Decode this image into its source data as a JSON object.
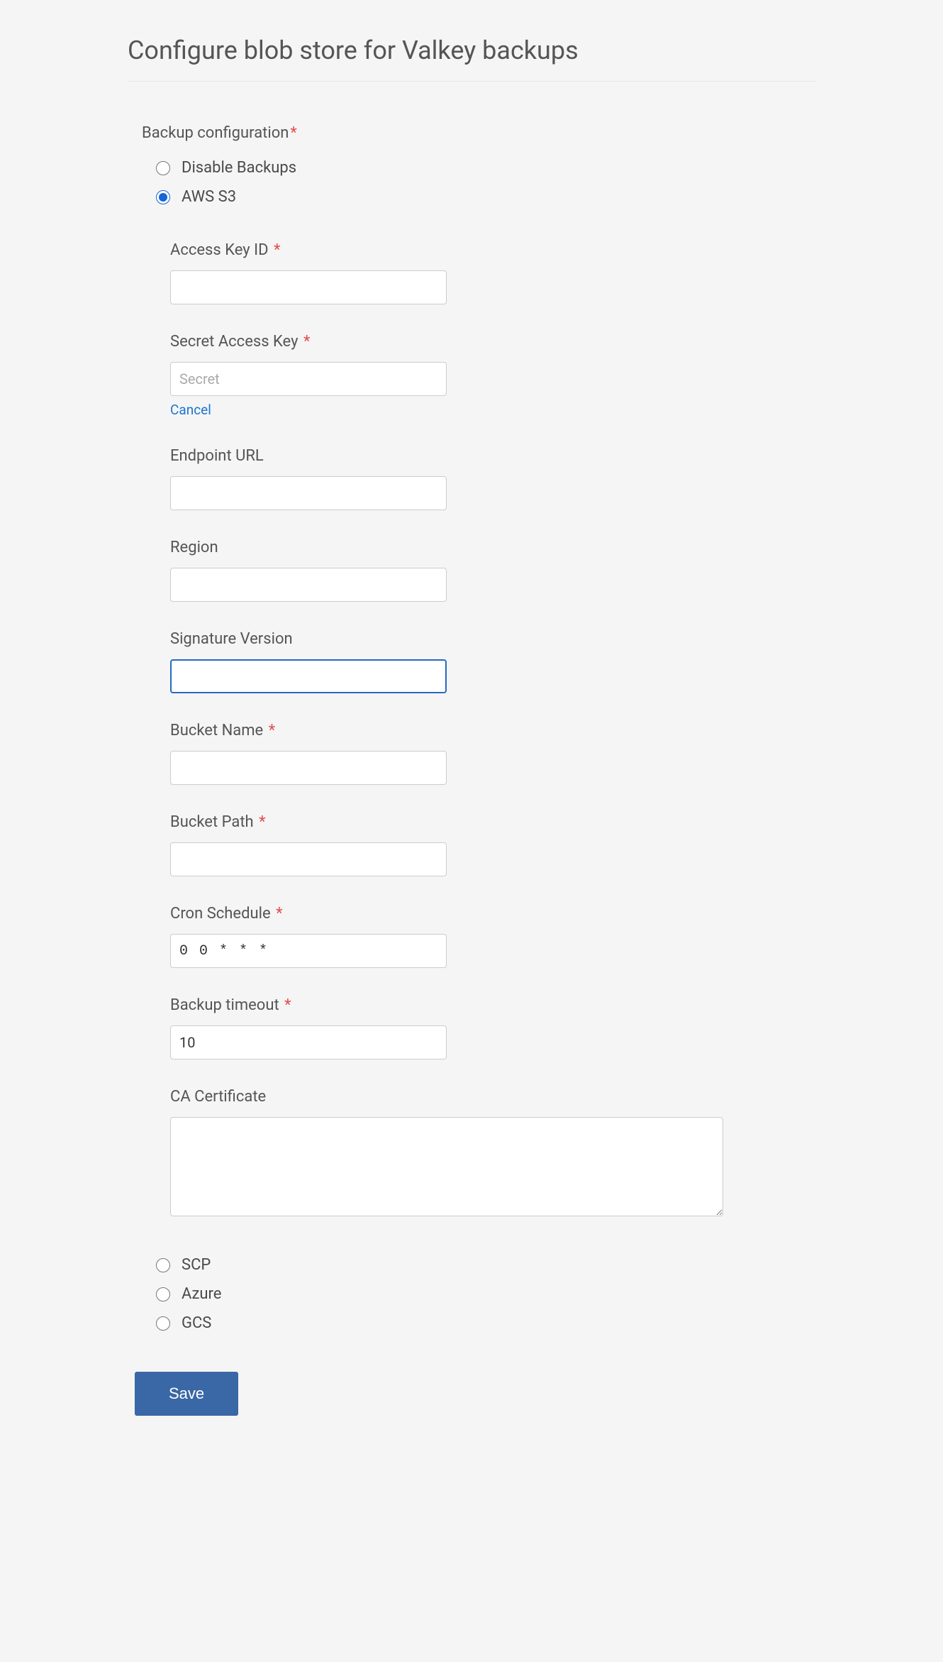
{
  "page": {
    "title": "Configure blob store for Valkey backups"
  },
  "section": {
    "label": "Backup configuration"
  },
  "radios": {
    "disable": "Disable Backups",
    "aws": "AWS S3",
    "scp": "SCP",
    "azure": "Azure",
    "gcs": "GCS"
  },
  "fields": {
    "access_key_id": {
      "label": "Access Key ID",
      "value": ""
    },
    "secret_access_key": {
      "label": "Secret Access Key",
      "placeholder": "Secret",
      "value": "",
      "cancel": "Cancel"
    },
    "endpoint_url": {
      "label": "Endpoint URL",
      "value": ""
    },
    "region": {
      "label": "Region",
      "value": ""
    },
    "signature_version": {
      "label": "Signature Version",
      "value": ""
    },
    "bucket_name": {
      "label": "Bucket Name",
      "value": ""
    },
    "bucket_path": {
      "label": "Bucket Path",
      "value": ""
    },
    "cron_schedule": {
      "label": "Cron Schedule",
      "value": "0 0 * * *"
    },
    "backup_timeout": {
      "label": "Backup timeout",
      "value": "10"
    },
    "ca_certificate": {
      "label": "CA Certificate",
      "value": ""
    }
  },
  "actions": {
    "save": "Save"
  }
}
